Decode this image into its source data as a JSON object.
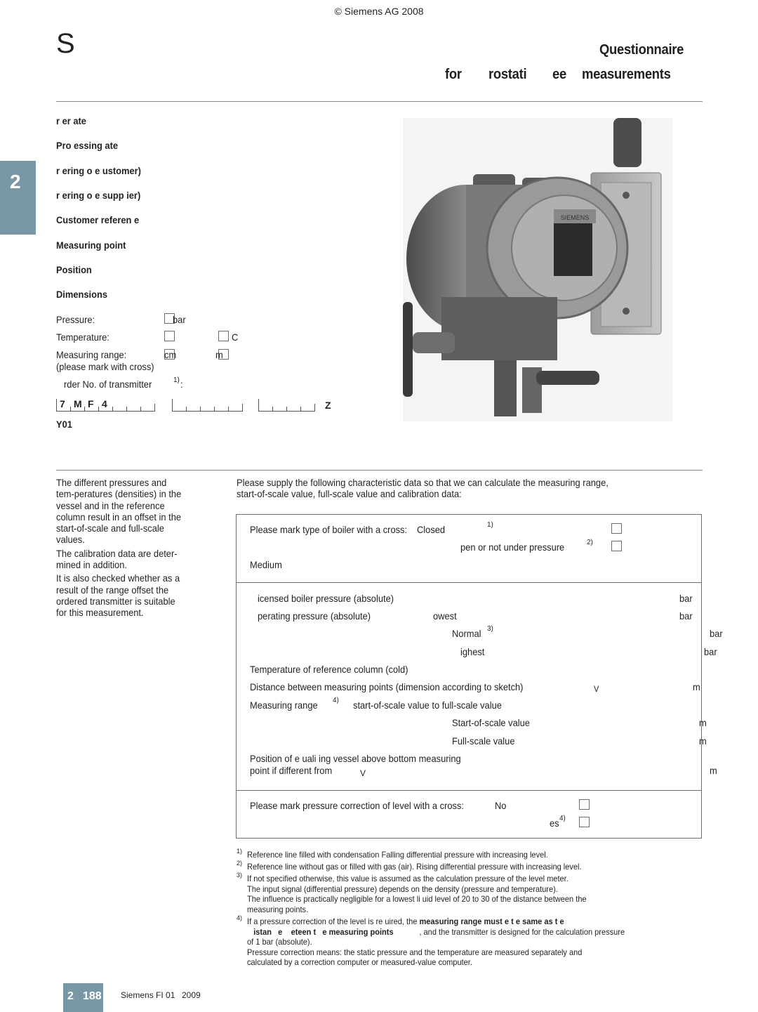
{
  "header": {
    "copyright": "© Siemens AG 2008",
    "logo_letter": "S",
    "title_line1": "Questionnaire",
    "title_line2_parts": [
      "for",
      "rostati",
      "ee",
      "measurements"
    ]
  },
  "chapter_tab": "2",
  "form_header": {
    "fields": [
      "r   er    ate",
      "Pro   essing    ate",
      "r   ering    o   e       ustomer)",
      "r   ering    o   e    supp   ier)",
      "Customer referen    e",
      "Measuring point",
      "Position",
      "Dimensions"
    ],
    "pressure_label": "Pressure:",
    "pressure_unit": "bar",
    "temperature_label": "Temperature:",
    "temperature_unit": "C",
    "range_label": "Measuring range:",
    "range_hint": "(please mark with cross)",
    "range_unit_1": "cm",
    "range_unit_2": "m",
    "order_label": "rder No. of transmitter",
    "order_sup": "1)",
    "order_colon": ":",
    "order_group1": [
      "7",
      "M",
      "F",
      "4",
      "",
      "",
      ""
    ],
    "order_group2": [
      "",
      "",
      "",
      "",
      ""
    ],
    "order_group3": [
      "",
      "",
      "",
      ""
    ],
    "order_suffix": "Z",
    "order_option": "Y01"
  },
  "product_image": {
    "alt": "Pressure transmitter with valve manifold",
    "brand_text": "SIEMENS"
  },
  "side_note": [
    "The different pressures and tem-peratures (densities) in the vessel and in the reference column result in an offset in the start-of-scale and full-scale values.",
    "The calibration data are deter-mined in addition.",
    "It is also checked whether     as a result of the range offset     the ordered transmitter is suitable for this measurement."
  ],
  "intro": "Please supply the following characteristic data so that we can calculate the measuring range, start-of-scale value, full-scale value and calibration data:",
  "boiler": {
    "label": "Please mark type of boiler with a cross:",
    "closed": "Closed",
    "closed_sup": "1)",
    "open": "pen or not under pressure",
    "open_sup": "2)",
    "medium": "Medium"
  },
  "pressures": {
    "licensed": "icensed boiler pressure (absolute)",
    "operating": "perating pressure (absolute)",
    "lowest": "owest",
    "normal": "Normal",
    "normal_sup": "3)",
    "highest": "ighest",
    "unit": "bar"
  },
  "temperature_ref": "Temperature of reference column (cold)",
  "distance": {
    "label": "Distance between measuring points (dimension according to sketch)",
    "symbol": "V",
    "unit": "m"
  },
  "measuring_range": {
    "label": "Measuring range",
    "sup": "4)",
    "desc": "start-of-scale value to full-scale value",
    "start": "Start-of-scale value",
    "full": "Full-scale value",
    "unit": "m"
  },
  "equalizing": {
    "line1": "Position of e    uali    ing vessel above bottom measuring",
    "line2": "point if different from",
    "symbol": "V",
    "unit": "m"
  },
  "correction": {
    "label": "Please mark pressure correction of level with a cross:",
    "no": "No",
    "yes": "es",
    "yes_sup": "4)"
  },
  "footnotes": [
    {
      "num": "1)",
      "lines": [
        "Reference line filled with condensation     Falling differential pressure with increasing level."
      ]
    },
    {
      "num": "2)",
      "lines": [
        "Reference line without gas or filled with gas (air). Rising differential pressure with increasing level."
      ]
    },
    {
      "num": "3)",
      "lines": [
        "If not specified otherwise, this value is assumed as the calculation pressure of the level meter.",
        "The input signal (differential pressure) depends on the density (pressure and temperature).",
        "The influence is practically negligible for a lowest li    uid level of 20 to 30     of the distance between the",
        "measuring points."
      ]
    },
    {
      "num": "4)",
      "line1_normal": "If a pressure correction of the level is re    uired, the ",
      "line1_bold": "measuring range must    e t   e same as t   e",
      "line2_bold": "   istan   e    eteen t   e measuring points",
      "line2_normal": "            , and the transmitter is designed for the calculation pressure",
      "lines": [
        "of 1 bar (absolute).",
        "Pressure correction means: the static pressure and the temperature are measured separately and",
        "calculated by a correction computer or measured-value computer."
      ]
    }
  ],
  "footer": {
    "chapter": "2",
    "page": "188",
    "catalog": "Siemens FI 01",
    "year": "2009"
  },
  "colors": {
    "accent": "#7a97a6",
    "text": "#231f20",
    "rule": "#8a8a8a"
  }
}
